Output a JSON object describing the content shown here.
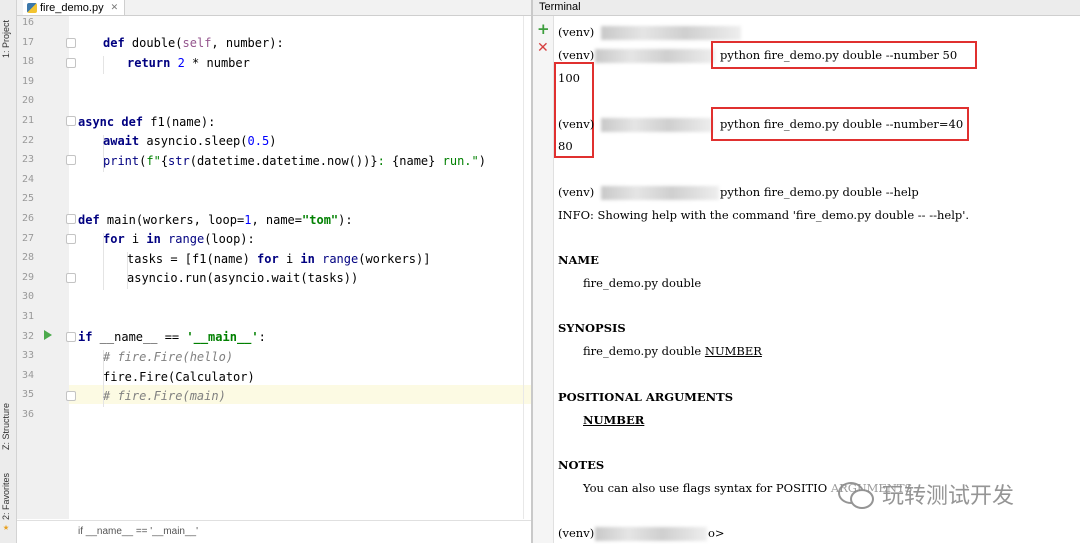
{
  "left_sidebar": {
    "project_tab": "1: Project",
    "structure_tab": "Z: Structure",
    "favorites_tab": "2: Favorites"
  },
  "editor": {
    "tab_label": "fire_demo.py",
    "line_numbers": [
      "16",
      "17",
      "18",
      "19",
      "20",
      "21",
      "22",
      "23",
      "24",
      "25",
      "26",
      "27",
      "28",
      "29",
      "30",
      "31",
      "32",
      "33",
      "34",
      "35",
      "36"
    ],
    "breadcrumb": "if __name__ == '__main__'"
  },
  "terminal": {
    "title": "Terminal",
    "lines": [
      "(venv)",
      "(venv)",
      "python fire_demo.py double --number 50",
      "100",
      "(venv)",
      "python fire_demo.py double --number=40",
      "80",
      "(venv)",
      "python fire_demo.py double --help",
      "INFO: Showing help with the command 'fire_demo.py double -- --help'.",
      "NAME",
      "fire_demo.py double",
      "SYNOPSIS",
      "fire_demo.py double ",
      "NUMBER",
      "POSITIONAL ARGUMENTS",
      "NUMBER",
      "NOTES",
      "You can also use flags syntax for POSITIO",
      "ARGUMENTS",
      "(venv)",
      "o>"
    ]
  },
  "watermark": "玩转测试开发"
}
